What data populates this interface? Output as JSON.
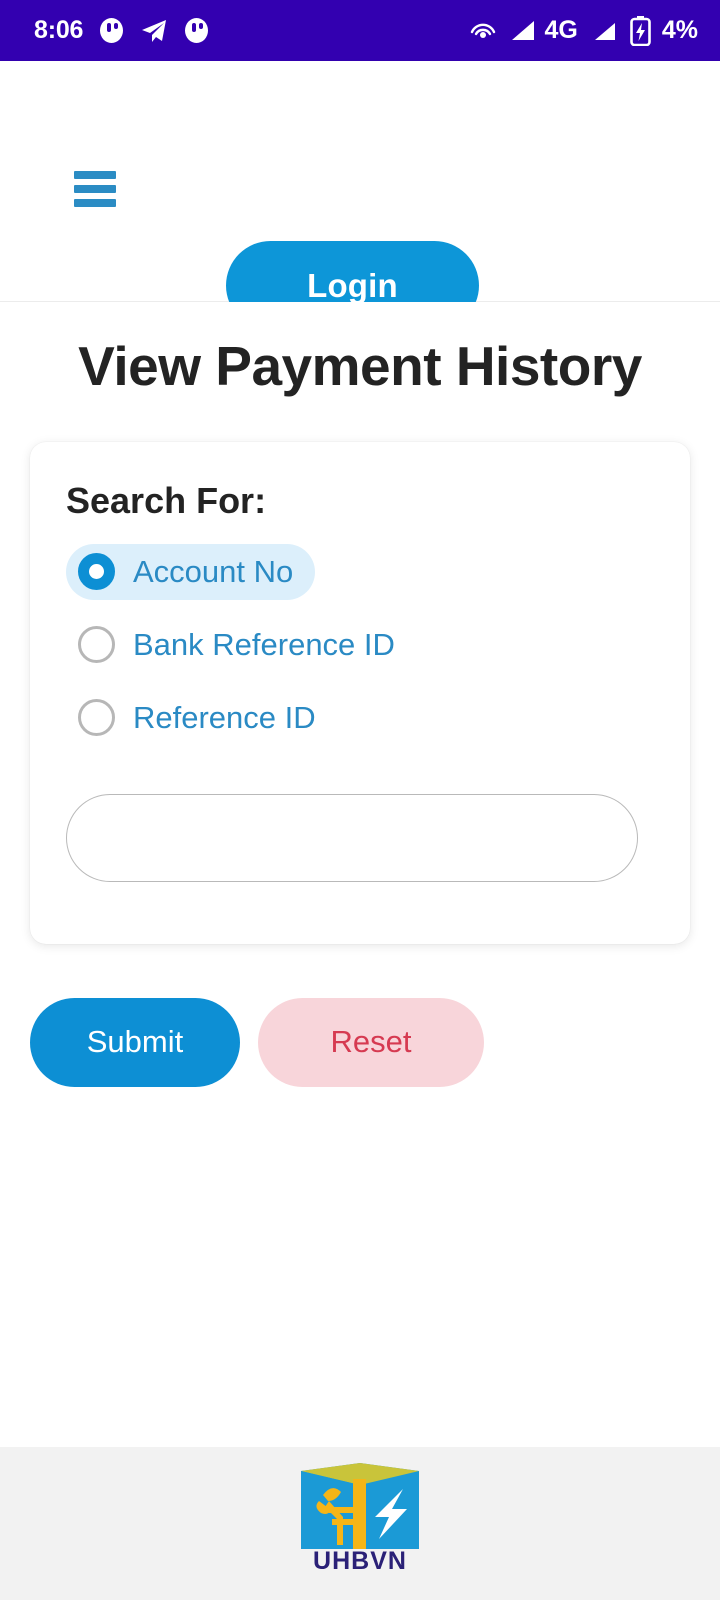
{
  "status_bar": {
    "time": "8:06",
    "background_color": "#3300b0",
    "left_icons": [
      "app-badge-icon",
      "telegram-plane-icon",
      "app-badge-icon"
    ],
    "network_label": "4G",
    "battery_label": "4%",
    "right_icons": [
      "cast-icon",
      "signal-bars-icon",
      "signal-bars-icon",
      "battery-charging-icon"
    ]
  },
  "header": {
    "menu_icon": "hamburger-menu-icon",
    "login_label": "Login",
    "login_color": "#0d96d8"
  },
  "main": {
    "page_title": "View Payment History",
    "card": {
      "search_for_label": "Search For:",
      "options": [
        {
          "label": "Account No",
          "selected": true
        },
        {
          "label": "Bank Reference ID",
          "selected": false
        },
        {
          "label": "Reference ID",
          "selected": false
        }
      ],
      "search_value": "",
      "search_placeholder": ""
    },
    "actions": {
      "submit_label": "Submit",
      "reset_label": "Reset",
      "submit_color": "#0d8fd4",
      "reset_bg_color": "#f8d5da",
      "reset_text_color": "#d63a51"
    }
  },
  "footer": {
    "logo_name": "uhbvn-logo-icon",
    "logo_text": "UHBVN",
    "background_color": "#f2f2f2"
  }
}
